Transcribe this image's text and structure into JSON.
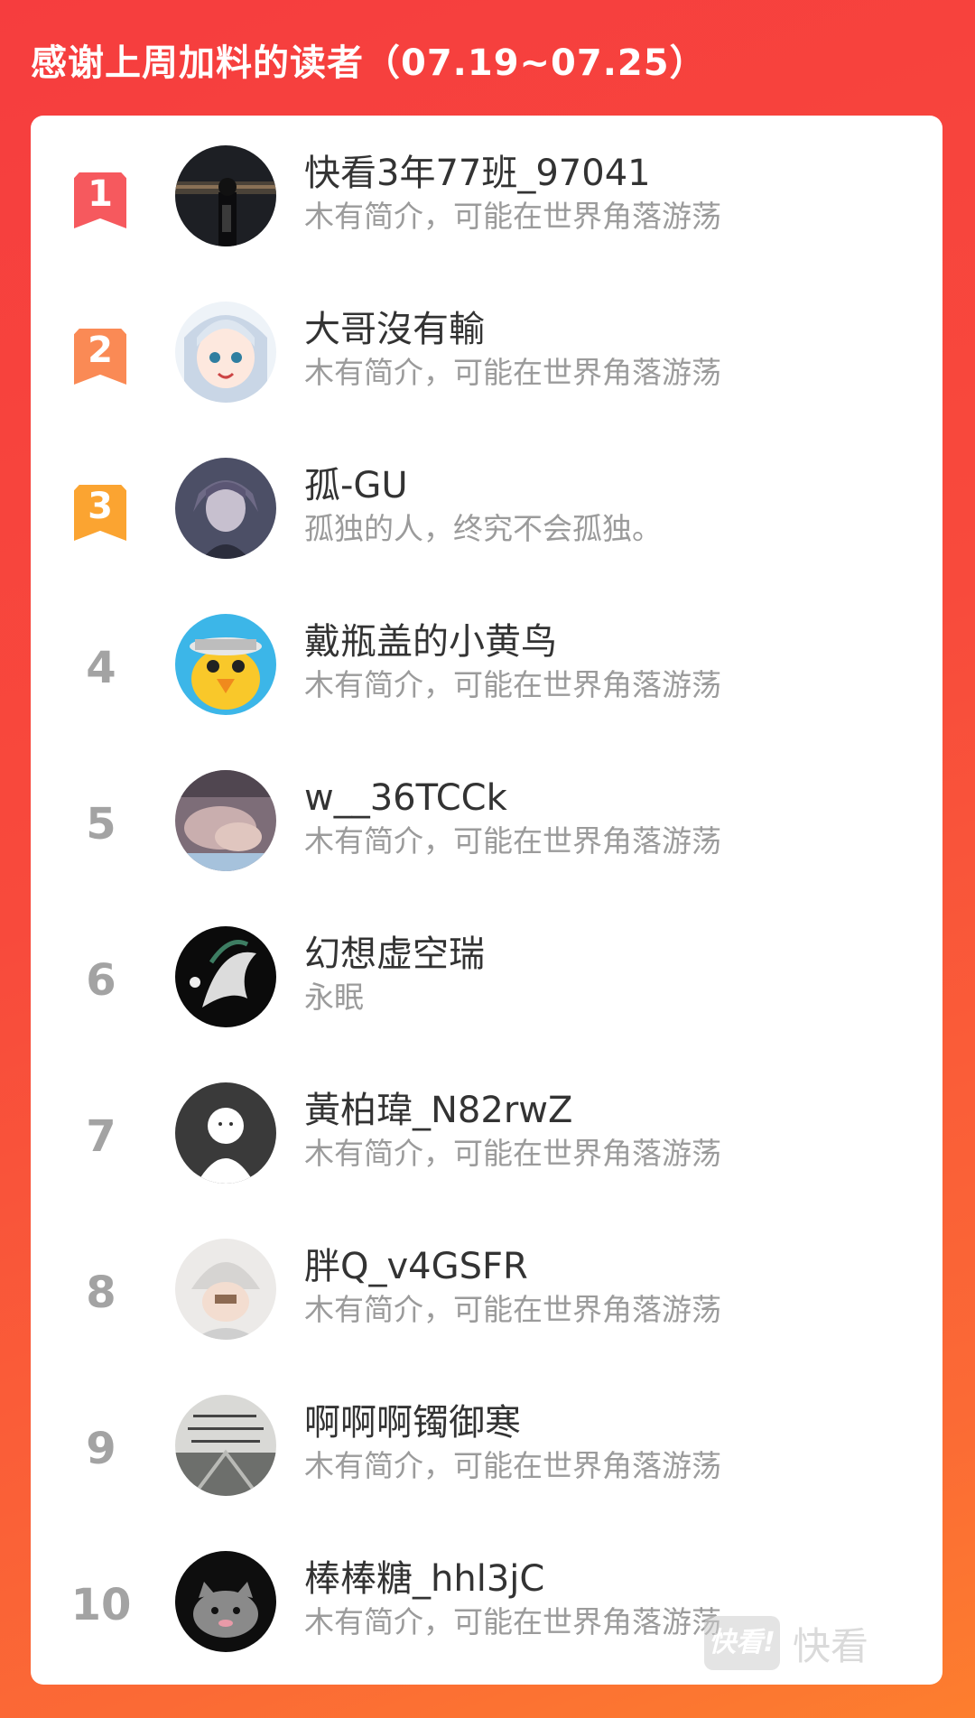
{
  "header": {
    "title": "感谢上周加料的读者（07.19~07.25）"
  },
  "colors": {
    "rank1": "#f6595e",
    "rank2": "#fa8a55",
    "rank3": "#fba431",
    "rank_plain": "#a3a3a3"
  },
  "readers": [
    {
      "rank": "1",
      "name": "快看3年77班_97041",
      "bio": "木有简介，可能在世界角落游荡",
      "avatar_icon": "dark-night-photo-avatar"
    },
    {
      "rank": "2",
      "name": "大哥沒有輸",
      "bio": "木有简介，可能在世界角落游荡",
      "avatar_icon": "anime-shark-girl-avatar"
    },
    {
      "rank": "3",
      "name": "孤-GU",
      "bio": "孤独的人，终究不会孤独。",
      "avatar_icon": "anime-boy-avatar"
    },
    {
      "rank": "4",
      "name": "戴瓶盖的小黄鸟",
      "bio": "木有简介，可能在世界角落游荡",
      "avatar_icon": "yellow-bird-avatar"
    },
    {
      "rank": "5",
      "name": "w__36TCCk",
      "bio": "木有简介，可能在世界角落游荡",
      "avatar_icon": "blurry-photo-avatar"
    },
    {
      "rank": "6",
      "name": "幻想虚空瑞",
      "bio": "永眠",
      "avatar_icon": "dragon-art-avatar"
    },
    {
      "rank": "7",
      "name": "黃柏瑋_N82rwZ",
      "bio": "木有简介，可能在世界角落游荡",
      "avatar_icon": "default-user-avatar"
    },
    {
      "rank": "8",
      "name": "胖Q_v4GSFR",
      "bio": "木有简介，可能在世界角落游荡",
      "avatar_icon": "hat-person-avatar"
    },
    {
      "rank": "9",
      "name": "啊啊啊镯御寒",
      "bio": "木有简介，可能在世界角落游荡",
      "avatar_icon": "handwriting-photo-avatar"
    },
    {
      "rank": "10",
      "name": "棒棒糖_hhl3jC",
      "bio": "木有简介，可能在世界角落游荡",
      "avatar_icon": "cartoon-cat-avatar"
    }
  ],
  "watermark": {
    "logo": "快看!",
    "text": "快看"
  }
}
